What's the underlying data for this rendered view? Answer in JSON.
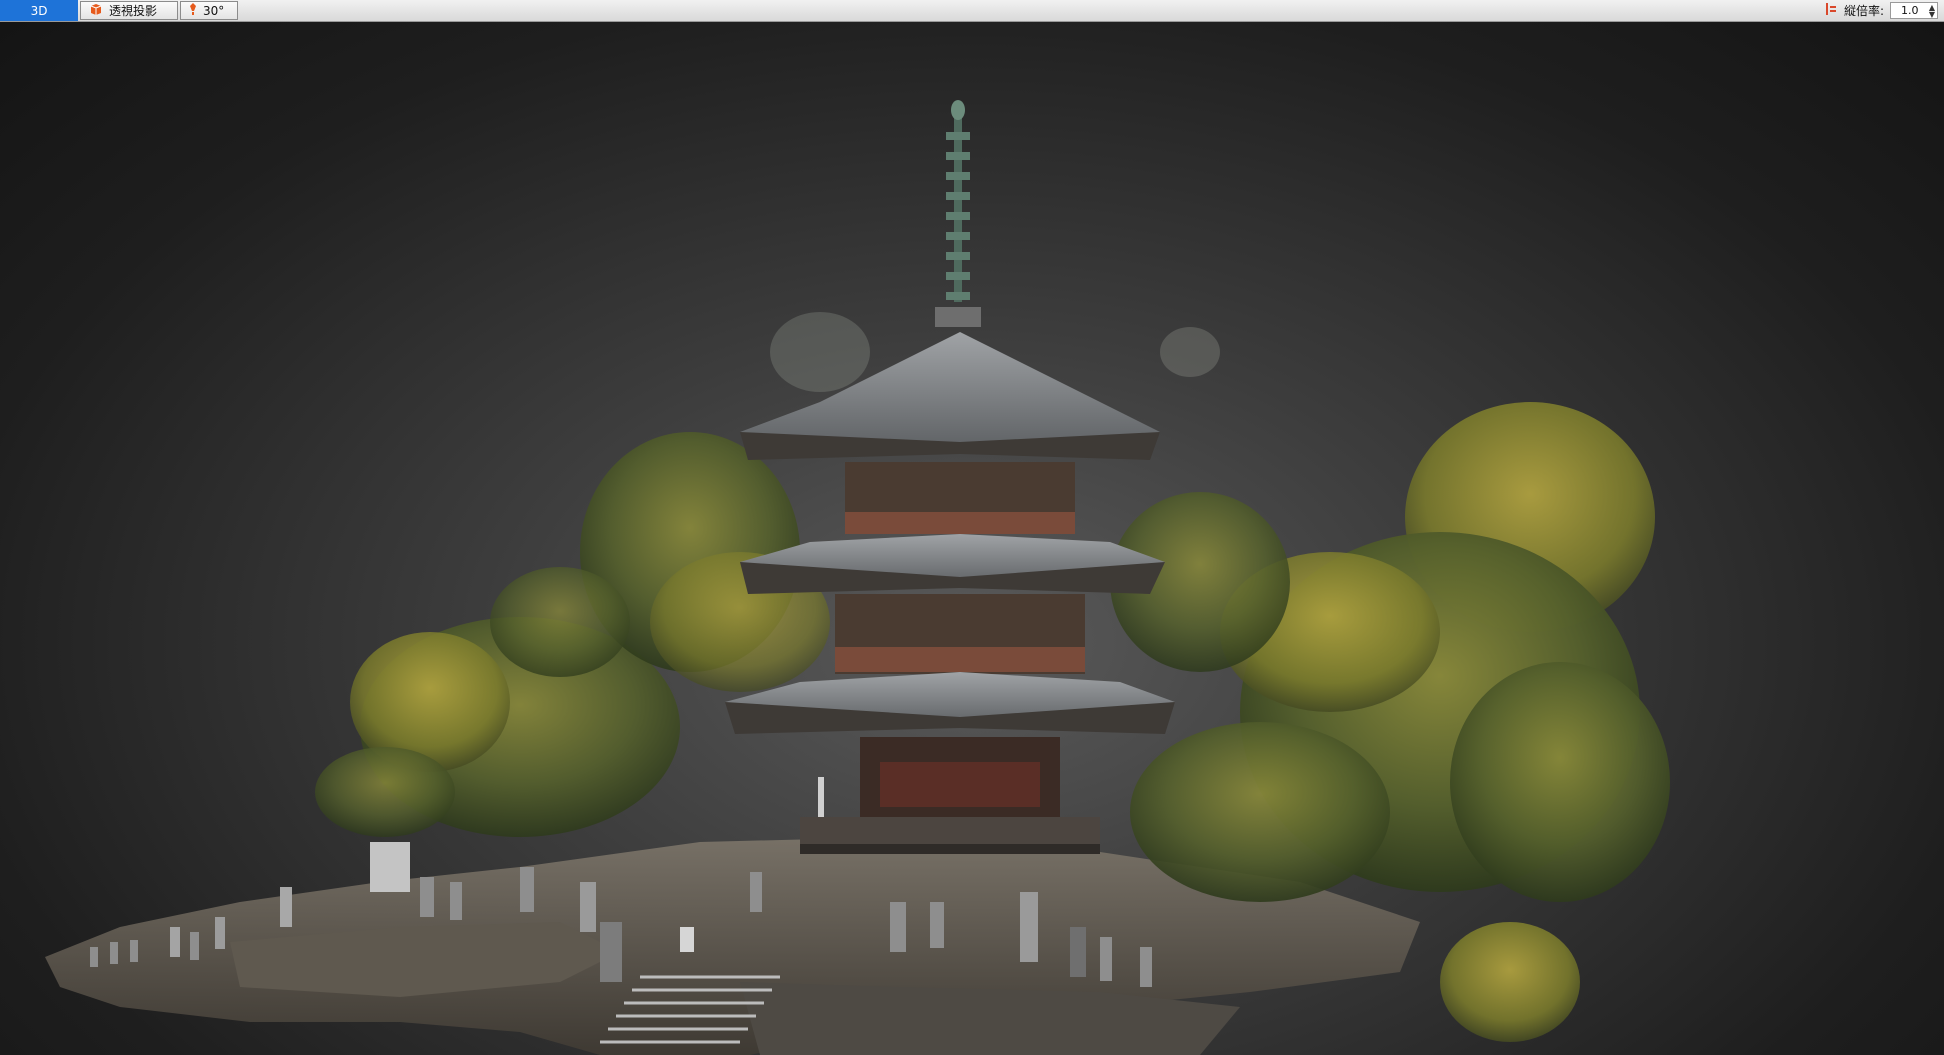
{
  "toolbar": {
    "mode_label": "3D",
    "projection_label": "透視投影",
    "fov_label": "30°",
    "scale_label": "縦倍率:",
    "scale_value": "1.0"
  },
  "icons": {
    "projection": "perspective-cube-icon",
    "fov": "camera-angle-icon",
    "scale": "vertical-scale-icon"
  },
  "colors": {
    "mode_active": "#1e73d8",
    "viewport_bg": "#2b2b2b"
  }
}
